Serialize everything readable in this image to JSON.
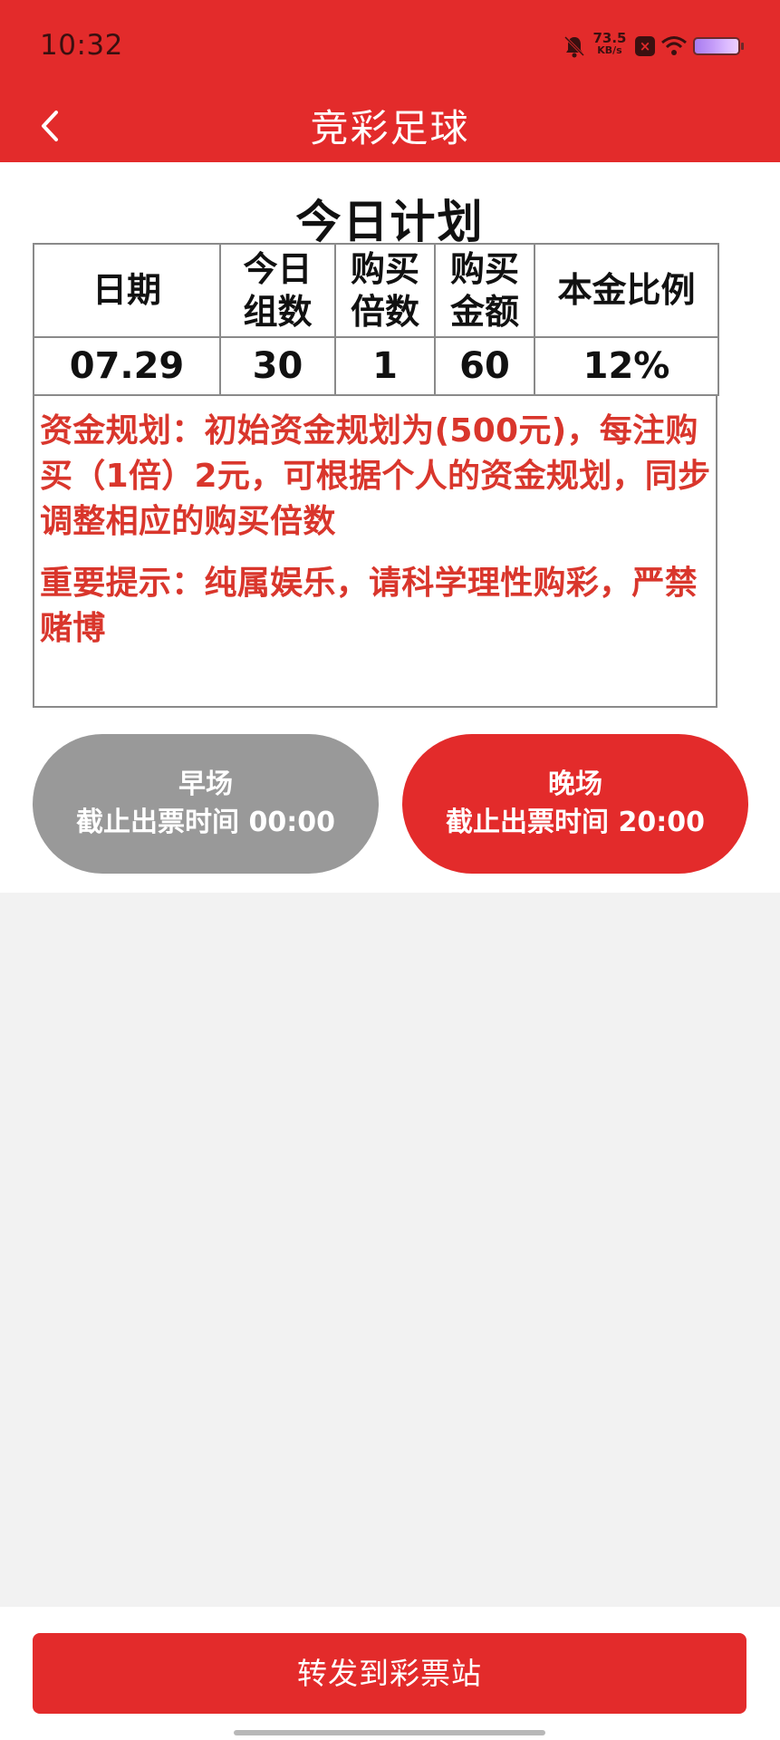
{
  "status_bar": {
    "time": "10:32",
    "net_speed_value": "73.5",
    "net_speed_unit": "KB/s",
    "icons": [
      "mute-icon",
      "notification-icon",
      "wifi-icon",
      "battery-icon"
    ]
  },
  "header": {
    "title": "竞彩足球",
    "back_icon": "chevron-left-icon"
  },
  "plan": {
    "title": "今日计划",
    "columns": [
      {
        "line1": "日期",
        "line2": ""
      },
      {
        "line1": "今日",
        "line2": "组数"
      },
      {
        "line1": "购买",
        "line2": "倍数"
      },
      {
        "line1": "购买",
        "line2": "金额"
      },
      {
        "line1": "本金比例",
        "line2": ""
      }
    ],
    "row": [
      "07.29",
      "30",
      "1",
      "60",
      "12%"
    ],
    "notes": [
      "资金规划：初始资金规划为(500元)，每注购买（1倍）2元，可根据个人的资金规划，同步调整相应的购买倍数",
      "重要提示：纯属娱乐，请科学理性购彩，严禁赌博"
    ]
  },
  "sessions": [
    {
      "name": "早场",
      "deadline": "截止出票时间 00:00",
      "active": false
    },
    {
      "name": "晚场",
      "deadline": "截止出票时间 20:00",
      "active": true
    }
  ],
  "footer": {
    "button_label": "转发到彩票站"
  },
  "colors": {
    "brand_red": "#e32b2b",
    "note_red": "#d9362c",
    "inactive_gray": "#999999",
    "page_bg": "#f2f2f2"
  }
}
